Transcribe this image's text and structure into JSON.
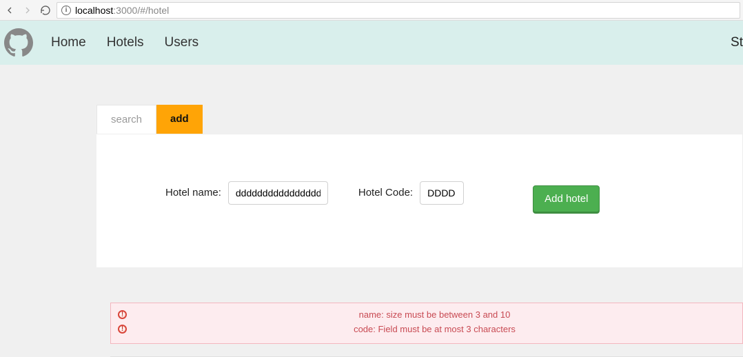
{
  "browser": {
    "url_host": "localhost",
    "url_port": ":3000",
    "url_path": "/#/hotel"
  },
  "nav": {
    "home": "Home",
    "hotels": "Hotels",
    "users": "Users",
    "right_partial": "St"
  },
  "tabs": {
    "search": "search",
    "add": "add"
  },
  "form": {
    "name_label": "Hotel name:",
    "name_value": "ddddddddddddddddd",
    "code_label": "Hotel Code:",
    "code_value": "DDDD",
    "submit_label": "Add hotel"
  },
  "errors": [
    "name: size must be between 3 and 10",
    "code: Field must be at most 3 characters"
  ]
}
